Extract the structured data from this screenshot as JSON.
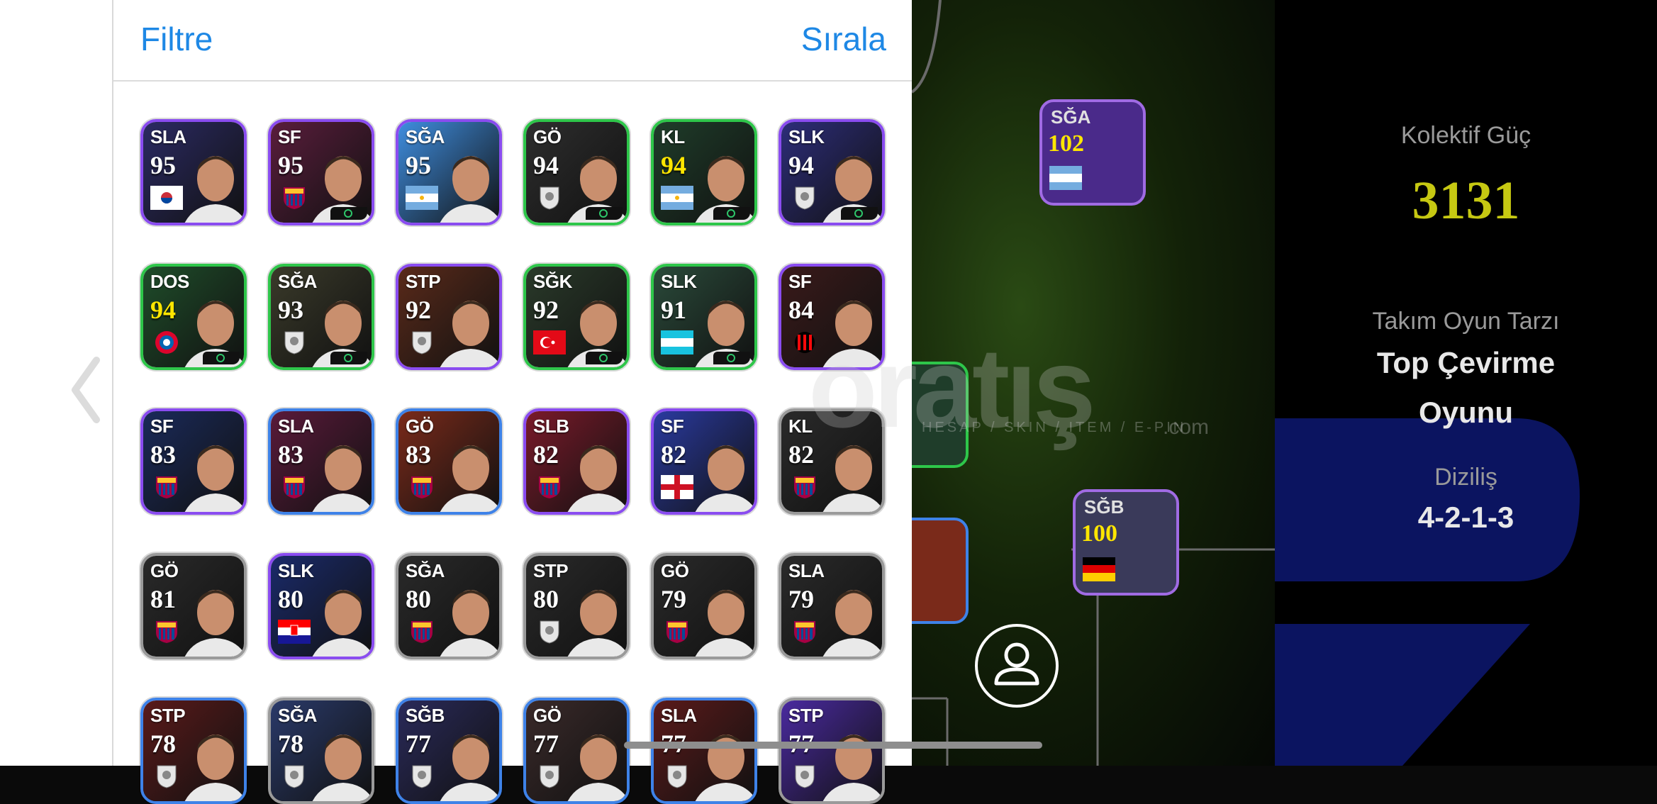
{
  "header": {
    "filter_label": "Filtre",
    "sort_label": "Sırala"
  },
  "players": [
    {
      "position": "SLA",
      "rating": "95",
      "emblem": "korea-flag",
      "frame": "#8a4cf0",
      "bg": "#2b2a63"
    },
    {
      "position": "SF",
      "rating": "95",
      "emblem": "barcelona-crest",
      "frame": "#8a4cf0",
      "bg": "#5a1d3c"
    },
    {
      "position": "SĞA",
      "rating": "95",
      "emblem": "argentina-flag",
      "frame": "#8a4cf0",
      "bg": "#3f8ee0"
    },
    {
      "position": "GÖ",
      "rating": "94",
      "emblem": "club-crest",
      "frame": "#2ec64a",
      "bg": "#2e2e2e"
    },
    {
      "position": "KL",
      "rating": "94",
      "rating_color": "yellow",
      "emblem": "argentina-flag",
      "frame": "#2ec64a",
      "bg": "#1f3d2a"
    },
    {
      "position": "SLK",
      "rating": "94",
      "emblem": "club-crest",
      "frame": "#8a4cf0",
      "bg": "#2d2d7a"
    },
    {
      "position": "DOS",
      "rating": "94",
      "rating_color": "yellow",
      "emblem": "bayern-crest",
      "frame": "#2ec64a",
      "bg": "#1f4d2a"
    },
    {
      "position": "SĞA",
      "rating": "93",
      "emblem": "club-crest",
      "frame": "#2ec64a",
      "bg": "#3a3a2a"
    },
    {
      "position": "STP",
      "rating": "92",
      "emblem": "club-crest",
      "frame": "#8a4cf0",
      "bg": "#5a2a1a"
    },
    {
      "position": "SĞK",
      "rating": "92",
      "emblem": "turkey-flag",
      "frame": "#2ec64a",
      "bg": "#2a3a2a"
    },
    {
      "position": "SLK",
      "rating": "91",
      "emblem": "honduras-flag",
      "frame": "#2ec64a",
      "bg": "#2a4a3a"
    },
    {
      "position": "SF",
      "rating": "84",
      "emblem": "milan-crest",
      "frame": "#8a4cf0",
      "bg": "#3a1a1a"
    },
    {
      "position": "SF",
      "rating": "83",
      "emblem": "barcelona-crest",
      "frame": "#8a4cf0",
      "bg": "#1a2a5a"
    },
    {
      "position": "SLA",
      "rating": "83",
      "emblem": "barcelona-crest",
      "frame": "#3e82e8",
      "bg": "#5a1a3a"
    },
    {
      "position": "GÖ",
      "rating": "83",
      "emblem": "barcelona-crest",
      "frame": "#3e82e8",
      "bg": "#7a2a1a"
    },
    {
      "position": "SLB",
      "rating": "82",
      "emblem": "barcelona-crest",
      "frame": "#8a4cf0",
      "bg": "#7a1a2a"
    },
    {
      "position": "SF",
      "rating": "82",
      "emblem": "england-flag",
      "frame": "#8a4cf0",
      "bg": "#2a3aa0"
    },
    {
      "position": "KL",
      "rating": "82",
      "emblem": "barcelona-crest",
      "frame": "#9a9a9a",
      "bg": "#2a2a2a"
    },
    {
      "position": "GÖ",
      "rating": "81",
      "emblem": "barcelona-crest",
      "frame": "#9a9a9a",
      "bg": "#2a2a2a"
    },
    {
      "position": "SLK",
      "rating": "80",
      "emblem": "croatia-flag",
      "frame": "#8a4cf0",
      "bg": "#1a2a6a"
    },
    {
      "position": "SĞA",
      "rating": "80",
      "emblem": "barcelona-crest",
      "frame": "#9a9a9a",
      "bg": "#2a2a2a"
    },
    {
      "position": "STP",
      "rating": "80",
      "emblem": "club-crest",
      "frame": "#9a9a9a",
      "bg": "#2a2a2a"
    },
    {
      "position": "GÖ",
      "rating": "79",
      "emblem": "barcelona-crest",
      "frame": "#9a9a9a",
      "bg": "#2a2a2a"
    },
    {
      "position": "SLA",
      "rating": "79",
      "emblem": "barcelona-crest",
      "frame": "#9a9a9a",
      "bg": "#2a2a2a"
    },
    {
      "position": "STP",
      "rating": "78",
      "emblem": "club-crest",
      "frame": "#3e82e8",
      "bg": "#5a1a1a"
    },
    {
      "position": "SĞA",
      "rating": "78",
      "emblem": "club-crest",
      "frame": "#9a9a9a",
      "bg": "#2a3a6a"
    },
    {
      "position": "SĞB",
      "rating": "77",
      "emblem": "club-crest",
      "frame": "#3e82e8",
      "bg": "#2a2a5a"
    },
    {
      "position": "GÖ",
      "rating": "77",
      "emblem": "club-crest",
      "frame": "#3e82e8",
      "bg": "#3a2a2a"
    },
    {
      "position": "SLA",
      "rating": "77",
      "emblem": "club-crest",
      "frame": "#3e82e8",
      "bg": "#5a1a1a"
    },
    {
      "position": "STP",
      "rating": "77",
      "emblem": "club-crest",
      "frame": "#9a9a9a",
      "bg": "#4a2aa0"
    }
  ],
  "pitch_cards": {
    "top": {
      "position": "SĞA",
      "rating": "102",
      "emblem": "argentina-flag"
    },
    "right": {
      "position": "SĞB",
      "rating": "100",
      "emblem": "germany-flag"
    }
  },
  "team_info": {
    "power_label": "Kolektif Güç",
    "power_value": "3131",
    "style_label": "Takım Oyun Tarzı",
    "style_value_line1": "Top Çevirme",
    "style_value_line2": "Oyunu",
    "formation_label": "Diziliş",
    "formation_value": "4-2-1-3"
  },
  "watermark": {
    "text": "oratış",
    "sub": "HESAP / SKIN / ITEM / E-PIN",
    "suffix": ".com"
  },
  "icons": {
    "back": "chevron-left-icon",
    "profile": "user-icon"
  }
}
